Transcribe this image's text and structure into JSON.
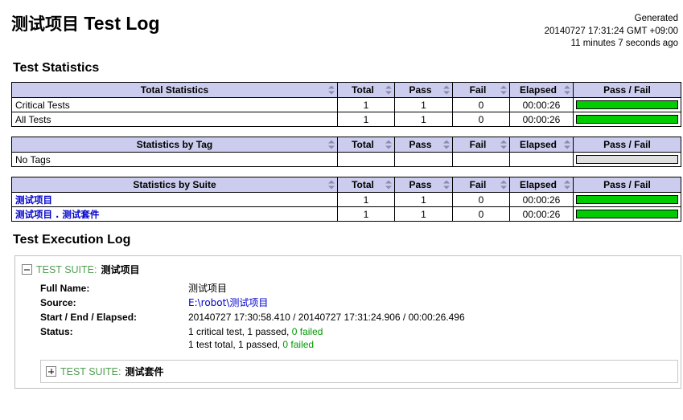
{
  "header": {
    "title_cjk": "测试项目",
    "title_en": "Test Log",
    "generated_label": "Generated",
    "generated_time": "20140727 17:31:24 GMT +09:00",
    "generated_ago": "11 minutes 7 seconds ago"
  },
  "sections": {
    "statistics": "Test Statistics",
    "execution_log": "Test Execution Log"
  },
  "columns": {
    "total": "Total",
    "pass": "Pass",
    "fail": "Fail",
    "elapsed": "Elapsed",
    "passfail": "Pass / Fail"
  },
  "tables": [
    {
      "name": "total-statistics",
      "title": "Total Statistics",
      "rows": [
        {
          "label": "Critical Tests",
          "is_link": false,
          "total": "1",
          "pass": "1",
          "fail": "0",
          "elapsed": "00:00:26",
          "pass_pct": 100,
          "fail_pct": 0,
          "empty_bar": false
        },
        {
          "label": "All Tests",
          "is_link": false,
          "total": "1",
          "pass": "1",
          "fail": "0",
          "elapsed": "00:00:26",
          "pass_pct": 100,
          "fail_pct": 0,
          "empty_bar": false
        }
      ]
    },
    {
      "name": "statistics-by-tag",
      "title": "Statistics by Tag",
      "rows": [
        {
          "label": "No Tags",
          "is_link": false,
          "total": "",
          "pass": "",
          "fail": "",
          "elapsed": "",
          "pass_pct": 0,
          "fail_pct": 0,
          "empty_bar": true
        }
      ]
    },
    {
      "name": "statistics-by-suite",
      "title": "Statistics by Suite",
      "rows": [
        {
          "label": "测试项目",
          "is_link": true,
          "total": "1",
          "pass": "1",
          "fail": "0",
          "elapsed": "00:00:26",
          "pass_pct": 100,
          "fail_pct": 0,
          "empty_bar": false
        },
        {
          "label": "测试项目 . 测试套件",
          "is_link": true,
          "total": "1",
          "pass": "1",
          "fail": "0",
          "elapsed": "00:00:26",
          "pass_pct": 100,
          "fail_pct": 0,
          "empty_bar": false
        }
      ]
    }
  ],
  "log": {
    "root_suite": {
      "kind": "TEST SUITE:",
      "name": "测试项目",
      "expanded": true,
      "meta": [
        {
          "label": "Full Name:",
          "value": "测试项目",
          "type": "text"
        },
        {
          "label": "Source:",
          "value": "E:\\robot\\测试项目",
          "type": "link"
        },
        {
          "label": "Start / End / Elapsed:",
          "value": "20140727 17:30:58.410 / 20140727 17:31:24.906 / 00:00:26.496",
          "type": "text"
        }
      ],
      "status_label": "Status:",
      "status_lines": [
        {
          "plain": "1 critical test, 1 passed, ",
          "ok": "0 failed"
        },
        {
          "plain": "1 test total, 1 passed, ",
          "ok": "0 failed"
        }
      ]
    },
    "child_suite": {
      "kind": "TEST SUITE:",
      "name": "测试套件",
      "expanded": false
    }
  },
  "colors": {
    "pass": "#00cc00",
    "fail": "#ff3333",
    "empty_bar": "#e0e0e0",
    "table_header": "#ccccee",
    "link": "#0000cc",
    "suite_kind": "#509e50",
    "ok_text": "#009900"
  }
}
